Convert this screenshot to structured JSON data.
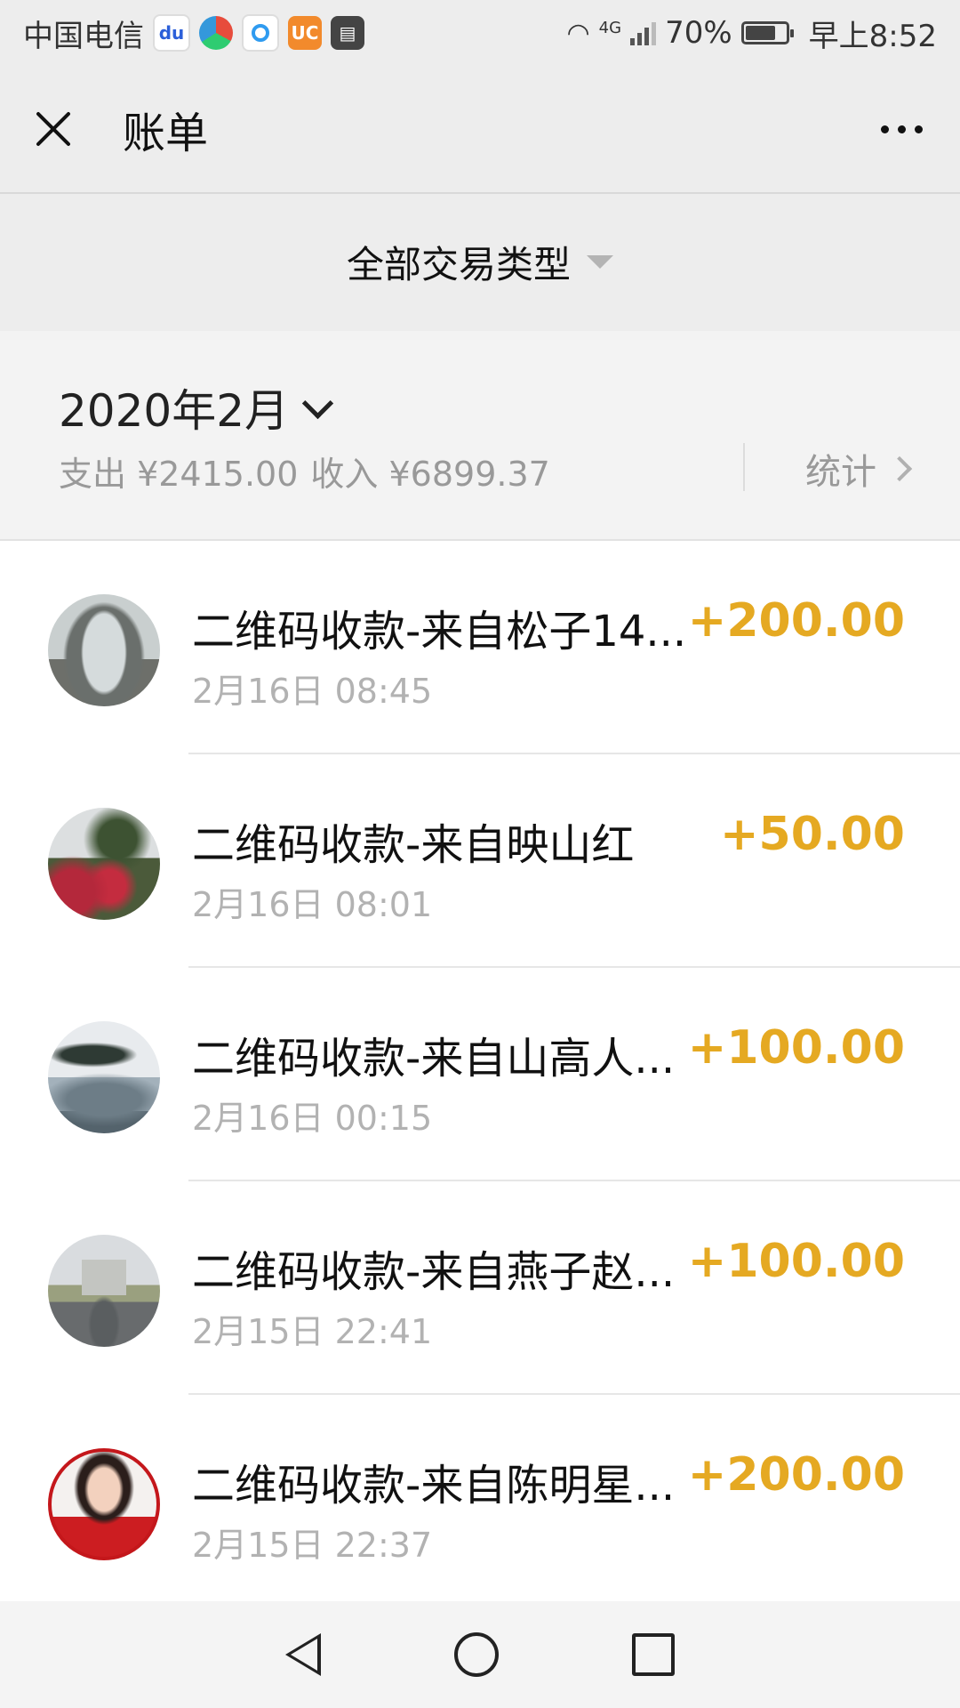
{
  "status_bar": {
    "carrier": "中国电信",
    "apps": [
      "baidu-icon",
      "camera-app-icon",
      "browser-icon",
      "uc-browser-icon",
      "reader-app-icon"
    ],
    "network": "4G",
    "battery": "70%",
    "battery_level": 0.7,
    "time": "早上8:52"
  },
  "header": {
    "title": "账单"
  },
  "filter": {
    "label": "全部交易类型"
  },
  "month": {
    "label": "2020年2月",
    "expense": "支出 ¥2415.00",
    "income": "收入 ¥6899.37",
    "stats_label": "统计"
  },
  "transactions": [
    {
      "name": "二维码收款-来自松子14...",
      "time": "2月16日 08:45",
      "amount": "+200.00"
    },
    {
      "name": "二维码收款-来自映山红",
      "time": "2月16日 08:01",
      "amount": "+50.00"
    },
    {
      "name": "二维码收款-来自山高人...",
      "time": "2月16日 00:15",
      "amount": "+100.00"
    },
    {
      "name": "二维码收款-来自燕子赵...",
      "time": "2月15日 22:41",
      "amount": "+100.00"
    },
    {
      "name": "二维码收款-来自陈明星...",
      "time": "2月15日 22:37",
      "amount": "+200.00"
    }
  ],
  "colors": {
    "amount": "#e5a922",
    "background": "#ededed",
    "muted_text": "#b2b2b2"
  }
}
